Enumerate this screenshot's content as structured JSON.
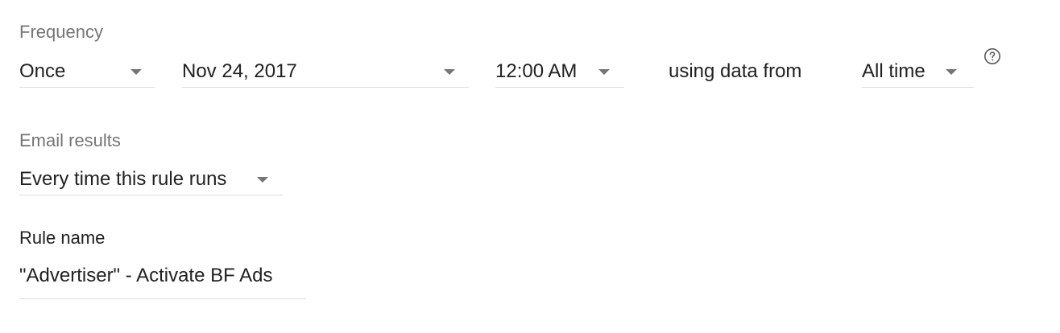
{
  "frequency": {
    "label": "Frequency",
    "repeat_value": "Once",
    "date_value": "Nov 24, 2017",
    "time_value": "12:00 AM",
    "using_data_text": "using data from",
    "range_value": "All time"
  },
  "email": {
    "label": "Email results",
    "value": "Every time this rule runs"
  },
  "rule": {
    "label": "Rule name",
    "value": "\"Advertiser\" - Activate BF Ads"
  },
  "icons": {
    "help": "help-circle-icon",
    "dropdown": "chevron-down-icon"
  },
  "colors": {
    "label": "#757575",
    "text": "#212121",
    "underline": "#dcdcdc"
  }
}
